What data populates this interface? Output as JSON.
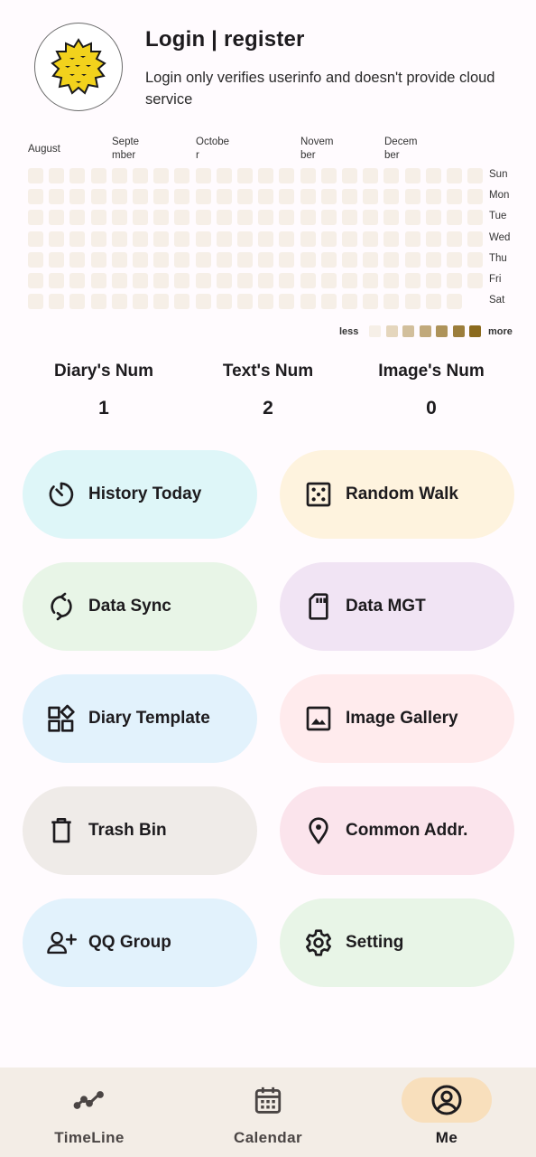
{
  "header": {
    "title": "Login | register",
    "subtitle": "Login only verifies userinfo and doesn't provide cloud service",
    "avatar_icon": "durian-icon"
  },
  "heatmap": {
    "months": [
      "August",
      "Septe\nmber",
      "Octobe\nr",
      "Novem\nber",
      "Decem\nber"
    ],
    "days": [
      "Sun",
      "Mon",
      "Tue",
      "Wed",
      "Thu",
      "Fri",
      "Sat"
    ],
    "weeks": 22,
    "last_week_days": 6,
    "legend_less": "less",
    "legend_more": "more",
    "legend_colors": [
      "#f6efe7",
      "#e5d6bd",
      "#d2bf9c",
      "#c1a97b",
      "#ae935a",
      "#9c7e3c",
      "#8b6a1e"
    ],
    "cell_color": "#f6efe7"
  },
  "stats": [
    {
      "label": "Diary's Num",
      "value": "1"
    },
    {
      "label": "Text's Num",
      "value": "2"
    },
    {
      "label": "Image's Num",
      "value": "0"
    }
  ],
  "buttons": [
    {
      "label": "History Today",
      "icon": "timer-icon",
      "color": "#def6f8"
    },
    {
      "label": "Random Walk",
      "icon": "dice-icon",
      "color": "#fef3de"
    },
    {
      "label": "Data Sync",
      "icon": "sync-icon",
      "color": "#e8f5e7"
    },
    {
      "label": "Data MGT",
      "icon": "sd-card-icon",
      "color": "#f1e4f4"
    },
    {
      "label": "Diary Template",
      "icon": "widgets-icon",
      "color": "#e2f2fc"
    },
    {
      "label": "Image Gallery",
      "icon": "image-icon",
      "color": "#ffebed"
    },
    {
      "label": "Trash Bin",
      "icon": "trash-icon",
      "color": "#efebe8"
    },
    {
      "label": "Common Addr.",
      "icon": "location-icon",
      "color": "#fbe4ec"
    },
    {
      "label": "QQ Group",
      "icon": "add-user-icon",
      "color": "#e2f2fc"
    },
    {
      "label": "Setting",
      "icon": "gear-icon",
      "color": "#e8f5e7"
    }
  ],
  "nav": {
    "items": [
      {
        "label": "TimeLine",
        "icon": "timeline-icon"
      },
      {
        "label": "Calendar",
        "icon": "calendar-icon"
      },
      {
        "label": "Me",
        "icon": "account-icon"
      }
    ],
    "selected": "Me",
    "selected_color": "#f8dfbc"
  }
}
